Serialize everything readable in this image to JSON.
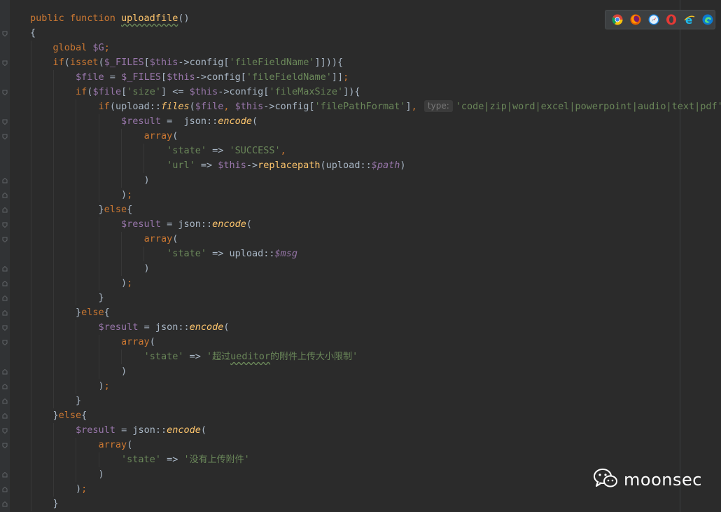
{
  "browser_bar": {
    "icons": [
      "chrome-icon",
      "firefox-icon",
      "safari-icon",
      "opera-icon",
      "internet-explorer-icon",
      "edge-icon"
    ]
  },
  "code": {
    "lines": [
      "public function uploadfile()",
      "{",
      "    global $G;",
      "    if(isset($_FILES[$this->config['fileFieldName']])){",
      "        $file = $_FILES[$this->config['fileFieldName']];",
      "        if($file['size'] <= $this->config['fileMaxSize']){",
      "            if(upload::files($file, $this->config['filePathFormat'], 'code|zip|word|excel|powerpoint|audio|text|pdf'))",
      "                $result =  json::encode(",
      "                    array(",
      "                        'state' => 'SUCCESS',",
      "                        'url' => $this->replacepath(upload::$path)",
      "                    )",
      "                );",
      "            }else{",
      "                $result = json::encode(",
      "                    array(",
      "                        'state' => upload::$msg",
      "                    )",
      "                );",
      "            }",
      "        }else{",
      "            $result = json::encode(",
      "                array(",
      "                    'state' => '超过ueditor的附件上传大小限制'",
      "                )",
      "            );",
      "        }",
      "    }else{",
      "        $result = json::encode(",
      "            array(",
      "                'state' => '没有上传附件'",
      "            )",
      "        );",
      "    }"
    ],
    "param_hint": "type:"
  },
  "colors": {
    "background": "#2b2b2b",
    "keyword": "#cc7832",
    "function": "#ffc66d",
    "variable": "#9876aa",
    "string": "#6a8759",
    "text": "#a9b7c6"
  },
  "watermark": {
    "icon": "wechat-icon",
    "text": "moonsec"
  }
}
